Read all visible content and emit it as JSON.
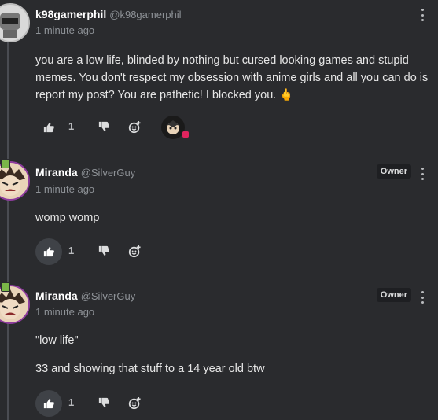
{
  "posts": [
    {
      "author": "k98gamerphil",
      "handle": "@k98gamerphil",
      "time": "1 minute ago",
      "text": "you are a low life, blinded by nothing but cursed looking games and stupid memes. You don't respect my obsession with anime girls and all you can do is report my post? You are pathetic!  I blocked you. 🖕",
      "likes": "1"
    },
    {
      "author": "Miranda",
      "handle": "@SilverGuy",
      "time": "1 minute ago",
      "tag": "Owner",
      "text": "womp womp",
      "likes": "1"
    },
    {
      "author": "Miranda",
      "handle": "@SilverGuy",
      "time": "1 minute ago",
      "tag": "Owner",
      "text1": "\"low life\"",
      "text2": "33 and showing that stuff to a 14 year old btw",
      "likes": "1"
    }
  ],
  "colors": {
    "background": "#2a2b2e",
    "owner_tag_bg": "#1e1f22",
    "avatar_ring": "#8e3c9e"
  }
}
